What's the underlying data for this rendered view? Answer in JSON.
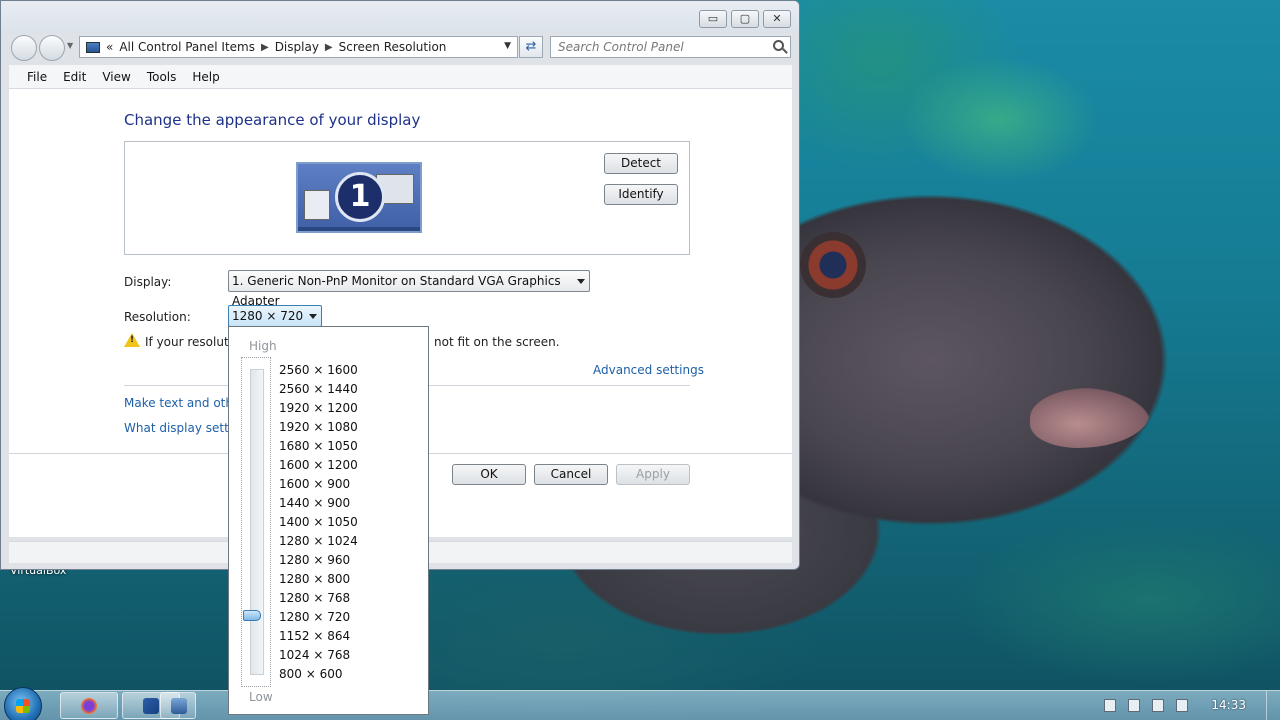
{
  "desktop": {
    "label": "VirtualBox"
  },
  "window": {
    "controls": {
      "minimize": "▭",
      "maximize": "▢",
      "close": "✕"
    },
    "address": {
      "prefix": "«",
      "crumbs": [
        "All Control Panel Items",
        "Display",
        "Screen Resolution"
      ]
    },
    "search": {
      "placeholder": "Search Control Panel"
    },
    "menu": [
      "File",
      "Edit",
      "View",
      "Tools",
      "Help"
    ],
    "heading": "Change the appearance of your display",
    "monitor_number": "1",
    "detect_label": "Detect",
    "identify_label": "Identify",
    "display_label": "Display:",
    "display_value": "1. Generic Non-PnP Monitor on Standard VGA Graphics Adapter",
    "resolution_label": "Resolution:",
    "resolution_value": "1280 × 720",
    "warning_text_left": "If your resolutio",
    "warning_text_right": "not fit on the screen.",
    "advanced_link": "Advanced settings",
    "link_text_size": "Make text and other",
    "link_display_settings": "What display setting",
    "ok_label": "OK",
    "cancel_label": "Cancel",
    "apply_label": "Apply"
  },
  "resolution_popup": {
    "high_label": "High",
    "low_label": "Low",
    "options": [
      "2560 × 1600",
      "2560 × 1440",
      "1920 × 1200",
      "1920 × 1080",
      "1680 × 1050",
      "1600 × 1200",
      "1600 × 900",
      "1440 × 900",
      "1400 × 1050",
      "1280 × 1024",
      "1280 × 960",
      "1280 × 800",
      "1280 × 768",
      "1280 × 720",
      "1152 × 864",
      "1024 × 768",
      "800 × 600"
    ],
    "selected": "1280 × 720"
  },
  "taskbar": {
    "clock": "14:33"
  },
  "colors": {
    "heading": "#1e3287",
    "link": "#1d5fa8",
    "accent": "#3c7fb1"
  }
}
